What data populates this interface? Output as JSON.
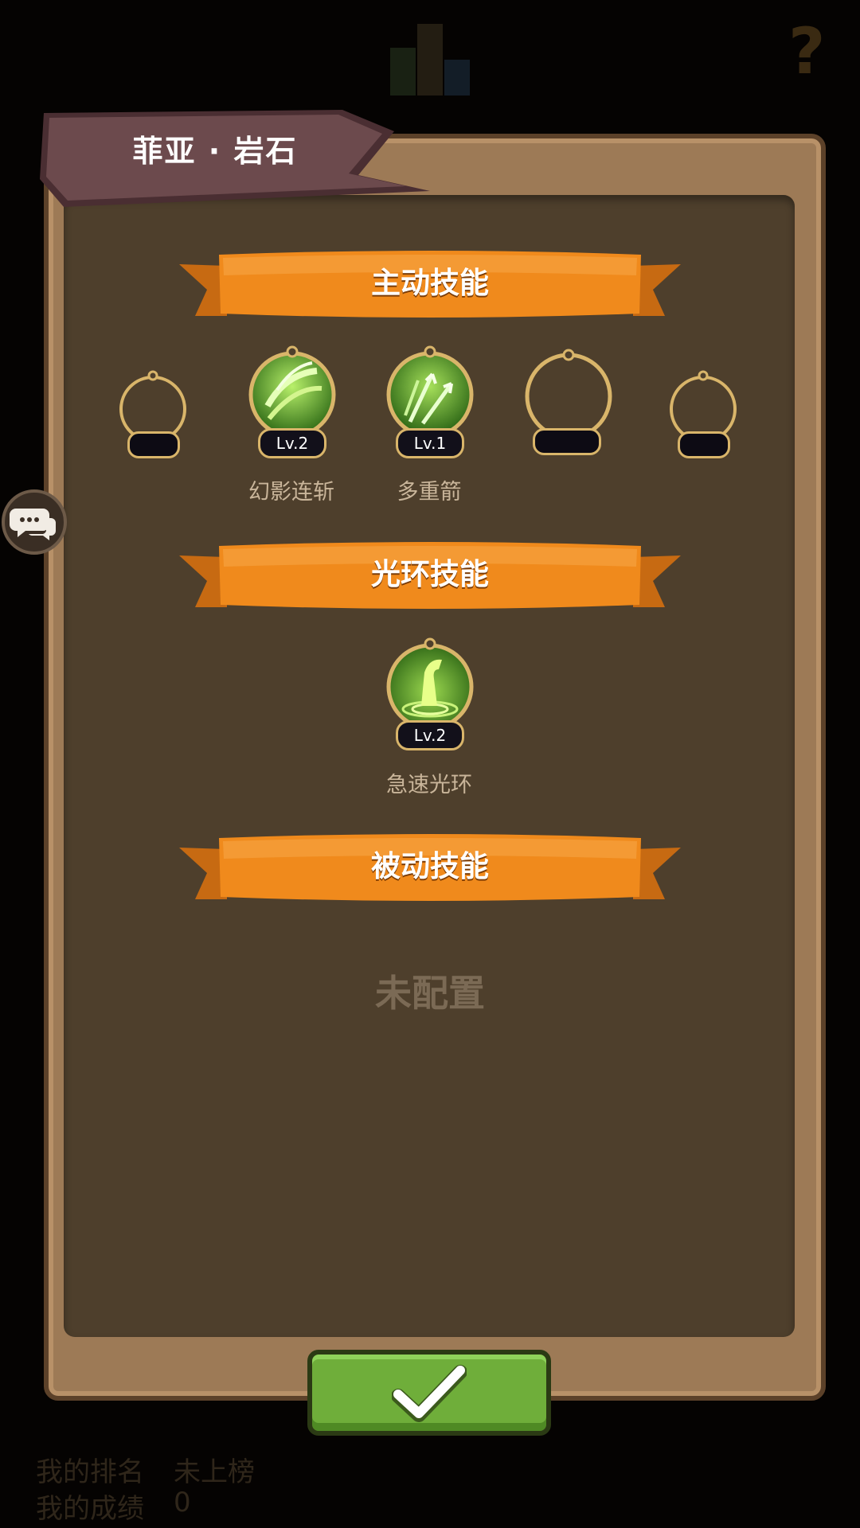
{
  "background": {
    "rank_label": "我的排名",
    "rank_value": "未上榜",
    "score_label": "我的成绩",
    "score_value": "0",
    "help_glyph": "?"
  },
  "hero_title": "菲亚 · 岩石",
  "sections": {
    "active": {
      "title": "主动技能"
    },
    "aura": {
      "title": "光环技能"
    },
    "passive": {
      "title": "被动技能",
      "empty_text": "未配置"
    }
  },
  "active_skills": [
    {
      "name": "",
      "level": ""
    },
    {
      "name": "幻影连斩",
      "level": "Lv.2"
    },
    {
      "name": "多重箭",
      "level": "Lv.1"
    },
    {
      "name": "",
      "level": ""
    },
    {
      "name": "",
      "level": ""
    }
  ],
  "aura_skills": [
    {
      "name": "急速光环",
      "level": "Lv.2"
    }
  ],
  "colors": {
    "ribbon": "#f08a1c",
    "confirm": "#6fae3a",
    "panel": "#4e3f2c",
    "frame_gold": "#d9b56a"
  },
  "icons": {
    "chat": "chat-bubbles-icon",
    "confirm": "checkmark-icon",
    "skill_1": "slash-skill-icon",
    "skill_2": "multi-arrow-skill-icon",
    "aura_1": "haste-boot-skill-icon"
  }
}
